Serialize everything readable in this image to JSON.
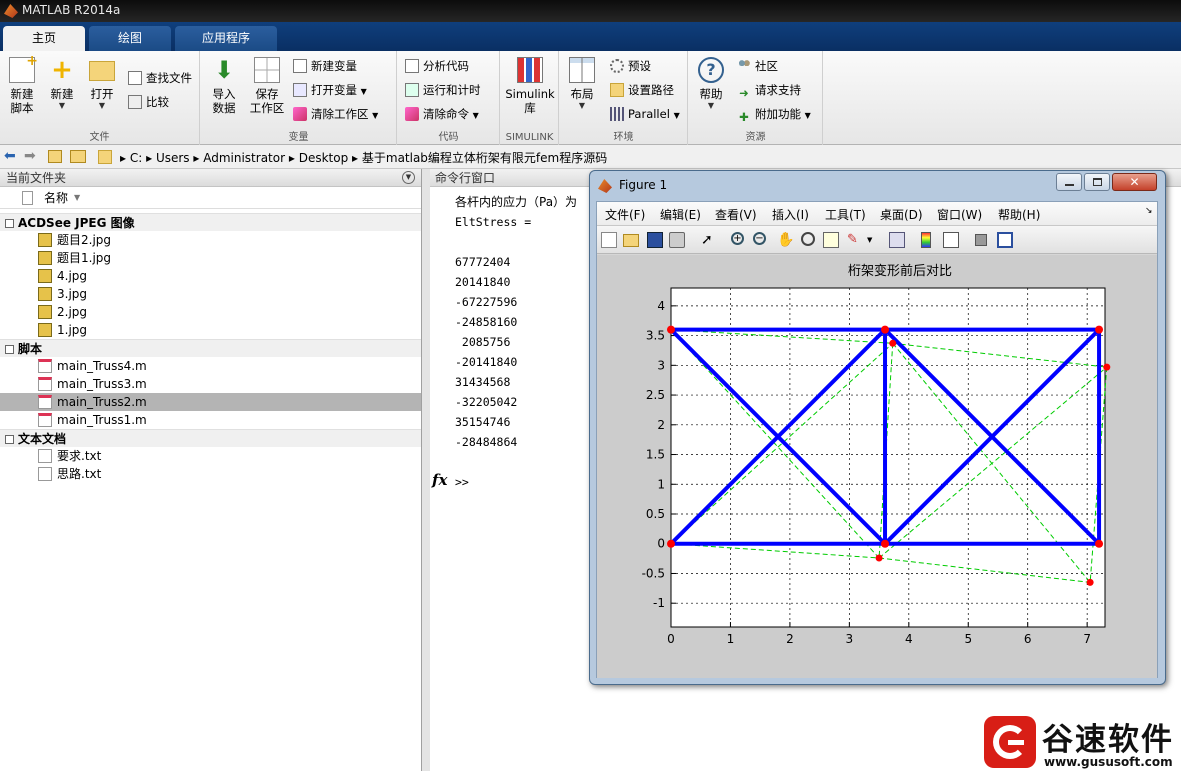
{
  "window": {
    "title": "MATLAB R2014a"
  },
  "tabs": [
    {
      "label": "主页"
    },
    {
      "label": "绘图"
    },
    {
      "label": "应用程序"
    }
  ],
  "ribbon": {
    "file": {
      "label": "文件",
      "new_script": "新建\n脚本",
      "new": "新建",
      "open": "打开",
      "find_files": "查找文件",
      "compare": "比较"
    },
    "variable": {
      "label": "变量",
      "import": "导入\n数据",
      "save_ws": "保存\n工作区",
      "new_var": "新建变量",
      "open_var": "打开变量",
      "clear_ws": "清除工作区"
    },
    "code": {
      "label": "代码",
      "analyze": "分析代码",
      "run_time": "运行和计时",
      "clear_cmd": "清除命令"
    },
    "simulink": {
      "label": "SIMULINK",
      "lib": "Simulink\n库"
    },
    "env": {
      "label": "环境",
      "layout": "布局",
      "prefs": "预设",
      "set_path": "设置路径",
      "parallel": "Parallel"
    },
    "resources": {
      "label": "资源",
      "help": "帮助",
      "community": "社区",
      "support": "请求支持",
      "addons": "附加功能"
    }
  },
  "address": {
    "path": [
      "C:",
      "Users",
      "Administrator",
      "Desktop",
      "基于matlab编程立体桁架有限元fem程序源码"
    ]
  },
  "current_folder": {
    "title": "当前文件夹",
    "name_col": "名称",
    "sections": [
      {
        "label": "ACDSee JPEG 图像",
        "items": [
          "题目2.jpg",
          "题目1.jpg",
          "4.jpg",
          "3.jpg",
          "2.jpg",
          "1.jpg"
        ]
      },
      {
        "label": "脚本",
        "items": [
          "main_Truss4.m",
          "main_Truss3.m",
          "main_Truss2.m",
          "main_Truss1.m"
        ]
      },
      {
        "label": "文本文档",
        "items": [
          "要求.txt",
          "思路.txt"
        ]
      }
    ]
  },
  "command": {
    "title": "命令行窗口",
    "line1": "各杆内的应力（Pa）为",
    "line2": "EltStress =",
    "values": [
      "67772404",
      "20141840",
      "-67227596",
      "-24858160",
      " 2085756",
      "-20141840",
      "31434568",
      "-32205042",
      "35154746",
      "-28484864"
    ],
    "fx": "fx",
    "prompt": ">>"
  },
  "figure": {
    "title": "Figure 1",
    "menu": [
      "文件(F)",
      "编辑(E)",
      "查看(V)",
      "插入(I)",
      "工具(T)",
      "桌面(D)",
      "窗口(W)",
      "帮助(H)"
    ]
  },
  "chart_data": {
    "type": "line",
    "title": "桁架变形前后对比",
    "xlim": [
      0,
      7.3
    ],
    "ylim": [
      -1.4,
      4.3
    ],
    "xticks": [
      0,
      1,
      2,
      3,
      4,
      5,
      6,
      7
    ],
    "yticks": [
      -1,
      -0.5,
      0,
      0.5,
      1,
      1.5,
      2,
      2.5,
      3,
      3.5,
      4
    ],
    "grid": true,
    "series": [
      {
        "style": "original",
        "color": "#0000ff",
        "segments": [
          [
            [
              0,
              3.6
            ],
            [
              3.6,
              3.6
            ]
          ],
          [
            [
              3.6,
              3.6
            ],
            [
              7.2,
              3.6
            ]
          ],
          [
            [
              0,
              0
            ],
            [
              3.6,
              0
            ]
          ],
          [
            [
              3.6,
              0
            ],
            [
              7.2,
              0
            ]
          ],
          [
            [
              0,
              3.6
            ],
            [
              3.6,
              0
            ]
          ],
          [
            [
              0,
              0
            ],
            [
              3.6,
              3.6
            ]
          ],
          [
            [
              3.6,
              3.6
            ],
            [
              3.6,
              0
            ]
          ],
          [
            [
              3.6,
              3.6
            ],
            [
              7.2,
              0
            ]
          ],
          [
            [
              3.6,
              0
            ],
            [
              7.2,
              3.6
            ]
          ],
          [
            [
              7.2,
              3.6
            ],
            [
              7.2,
              0
            ]
          ]
        ]
      },
      {
        "style": "deformed",
        "color": "#00cc00",
        "segments": [
          [
            [
              0,
              3.6
            ],
            [
              3.73,
              3.37
            ]
          ],
          [
            [
              3.73,
              3.37
            ],
            [
              7.33,
              2.97
            ]
          ],
          [
            [
              0,
              0
            ],
            [
              3.5,
              -0.24
            ]
          ],
          [
            [
              3.5,
              -0.24
            ],
            [
              7.05,
              -0.65
            ]
          ],
          [
            [
              0,
              3.6
            ],
            [
              3.5,
              -0.24
            ]
          ],
          [
            [
              0,
              0
            ],
            [
              3.73,
              3.37
            ]
          ],
          [
            [
              3.73,
              3.37
            ],
            [
              3.5,
              -0.24
            ]
          ],
          [
            [
              3.73,
              3.37
            ],
            [
              7.05,
              -0.65
            ]
          ],
          [
            [
              3.5,
              -0.24
            ],
            [
              7.33,
              2.97
            ]
          ],
          [
            [
              7.33,
              2.97
            ],
            [
              7.05,
              -0.65
            ]
          ]
        ]
      }
    ],
    "nodes_original": [
      [
        0,
        3.6
      ],
      [
        3.6,
        3.6
      ],
      [
        7.2,
        3.6
      ],
      [
        0,
        0
      ],
      [
        3.6,
        0
      ],
      [
        7.2,
        0
      ]
    ],
    "nodes_deformed": [
      [
        3.73,
        3.37
      ],
      [
        7.33,
        2.97
      ],
      [
        3.5,
        -0.24
      ],
      [
        7.05,
        -0.65
      ]
    ]
  },
  "watermark": {
    "brand": "谷速软件",
    "url": "www.gususoft.com"
  }
}
